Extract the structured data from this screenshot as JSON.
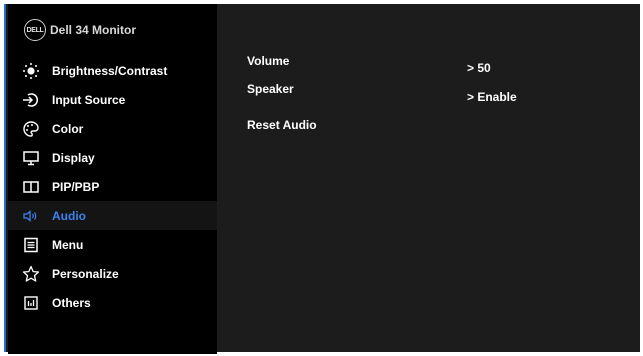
{
  "header": {
    "logo_text": "DELL",
    "title": "Dell 34 Monitor"
  },
  "menu": {
    "items": [
      {
        "label": "Brightness/Contrast",
        "icon": "brightness-icon"
      },
      {
        "label": "Input Source",
        "icon": "input-source-icon"
      },
      {
        "label": "Color",
        "icon": "color-palette-icon"
      },
      {
        "label": "Display",
        "icon": "display-monitor-icon"
      },
      {
        "label": "PIP/PBP",
        "icon": "pip-pbp-icon"
      },
      {
        "label": "Audio",
        "icon": "speaker-icon",
        "active": true
      },
      {
        "label": "Menu",
        "icon": "menu-list-icon"
      },
      {
        "label": "Personalize",
        "icon": "star-icon"
      },
      {
        "label": "Others",
        "icon": "others-icon"
      }
    ]
  },
  "audio": {
    "volume_label": "Volume",
    "volume_value": "> 50",
    "speaker_label": "Speaker",
    "speaker_value": "> Enable",
    "reset_label": "Reset Audio"
  },
  "colors": {
    "accent": "#3b82f0",
    "sidebar": "#000000",
    "panel": "#1c1c1c"
  }
}
